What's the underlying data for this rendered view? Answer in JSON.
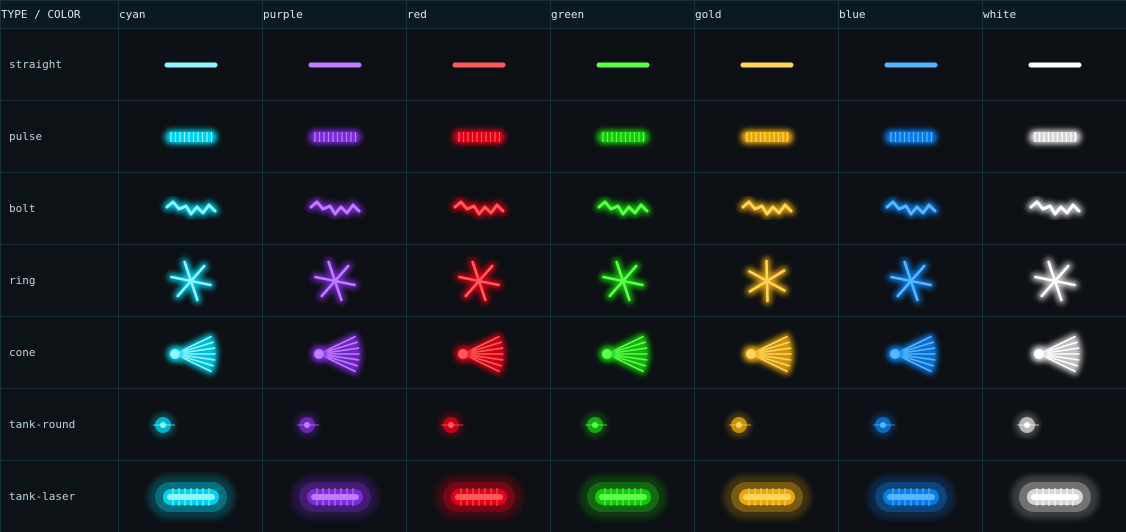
{
  "header": {
    "corner_label": "TYPE / COLOR",
    "columns": [
      "cyan",
      "purple",
      "red",
      "green",
      "gold",
      "blue",
      "white"
    ]
  },
  "rows": [
    "straight",
    "pulse",
    "bolt",
    "ring",
    "cone",
    "tank-round",
    "tank-laser"
  ],
  "colors": {
    "cyan": {
      "core": "#8ff6ff",
      "glow": "#00d2ee"
    },
    "purple": {
      "core": "#c07cff",
      "glow": "#7a2cd6"
    },
    "red": {
      "core": "#ff5a5a",
      "glow": "#e40018"
    },
    "green": {
      "core": "#5eff4a",
      "glow": "#17c70e"
    },
    "gold": {
      "core": "#ffd45a",
      "glow": "#e8a70d"
    },
    "blue": {
      "core": "#55b6ff",
      "glow": "#0a7be6"
    },
    "white": {
      "core": "#ffffff",
      "glow": "#d6d6d6"
    }
  }
}
